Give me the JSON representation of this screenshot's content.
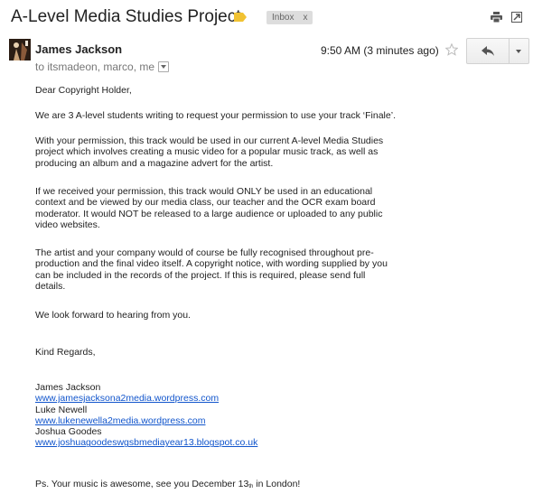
{
  "header": {
    "subject": "A-Level Media Studies Project",
    "label": "Inbox",
    "label_close": "x"
  },
  "message": {
    "sender": "James Jackson",
    "recipients": "to itsmadeon, marco, me",
    "timestamp": "9:50 AM (3 minutes ago)",
    "body": {
      "greeting": "Dear Copyright Holder,",
      "p1": "We are 3 A-level students writing to request your permission to use your track ‘Finale’.",
      "p2": [
        "With your permission, this track would be used in our current A-level Media Studies",
        "project which involves creating a music video for a popular music track, as well as",
        "producing an album and a magazine advert for the artist."
      ],
      "p3": [
        "If we received your permission, this track would ONLY be used in an educational",
        "context and be viewed by our media class, our teacher and the OCR exam board",
        "moderator. It would NOT be released to a large audience or uploaded to any public",
        "video websites."
      ],
      "p4": [
        "The artist and your company would of course be fully recognised throughout pre-",
        "production and the final video itself. A copyright notice, with wording supplied by you",
        "can be included in the records of the project. If this is required, please send full",
        "details."
      ],
      "p5": "We look forward to hearing from you.",
      "signoff": "Kind Regards,",
      "signatures": [
        {
          "name": "James Jackson",
          "link": "www.jamesjacksona2media.wordpress.com"
        },
        {
          "name": "Luke Newell",
          "link": "www.lukenewella2media.wordpress.com"
        },
        {
          "name": "Joshua Goodes",
          "link": "www.joshuagoodeswgsbmediayear13.blogspot.co.uk"
        }
      ],
      "ps": {
        "before": "Ps. Your music is awesome, see you December 13",
        "suffix": "th",
        "after": " in London!"
      }
    }
  },
  "colors": {
    "link": "#1155cc",
    "label_chip": "#dddddd",
    "important_marker": "#f1c232"
  },
  "icons": {
    "tag": "importance-marker-icon",
    "print": "print-icon",
    "new_window": "new-window-icon",
    "star": "star-icon",
    "reply": "reply-arrow-icon",
    "more": "chevron-down-icon"
  }
}
